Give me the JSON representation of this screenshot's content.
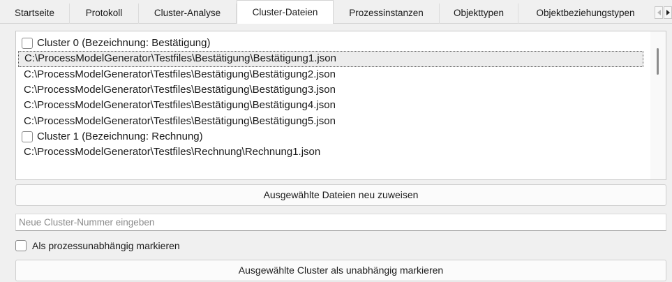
{
  "tabs": [
    {
      "label": "Startseite"
    },
    {
      "label": "Protokoll"
    },
    {
      "label": "Cluster-Analyse"
    },
    {
      "label": "Cluster-Dateien"
    },
    {
      "label": "Prozessinstanzen"
    },
    {
      "label": "Objekttypen"
    },
    {
      "label": "Objektbeziehungstypen"
    }
  ],
  "active_tab": "Cluster-Dateien",
  "list": {
    "items": [
      {
        "kind": "cluster",
        "label": "Cluster 0 (Bezeichnung: Bestätigung)",
        "checked": false
      },
      {
        "kind": "file",
        "label": "C:\\ProcessModelGenerator\\Testfiles\\Bestätigung\\Bestätigung1.json",
        "selected": true
      },
      {
        "kind": "file",
        "label": "C:\\ProcessModelGenerator\\Testfiles\\Bestätigung\\Bestätigung2.json"
      },
      {
        "kind": "file",
        "label": "C:\\ProcessModelGenerator\\Testfiles\\Bestätigung\\Bestätigung3.json"
      },
      {
        "kind": "file",
        "label": "C:\\ProcessModelGenerator\\Testfiles\\Bestätigung\\Bestätigung4.json"
      },
      {
        "kind": "file",
        "label": "C:\\ProcessModelGenerator\\Testfiles\\Bestätigung\\Bestätigung5.json"
      },
      {
        "kind": "cluster",
        "label": "Cluster 1 (Bezeichnung: Rechnung)",
        "checked": false
      },
      {
        "kind": "file",
        "label": "C:\\ProcessModelGenerator\\Testfiles\\Rechnung\\Rechnung1.json"
      }
    ]
  },
  "reassign_button": "Ausgewählte Dateien neu zuweisen",
  "cluster_number_input": {
    "placeholder": "Neue Cluster-Nummer eingeben",
    "value": ""
  },
  "independent_checkbox": {
    "label": "Als prozessunabhängig markieren",
    "checked": false
  },
  "mark_independent_button": "Ausgewählte Cluster als unabhängig markieren",
  "icons": {
    "scroll_left": "triangle-left-icon",
    "scroll_right": "triangle-right-icon"
  }
}
